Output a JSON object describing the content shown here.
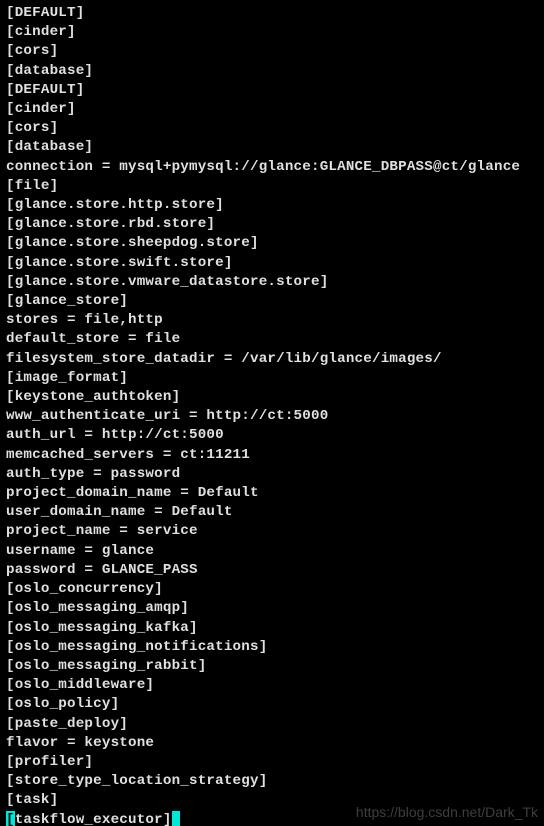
{
  "terminal": {
    "lines": [
      "[DEFAULT]",
      "[cinder]",
      "[cors]",
      "[database]",
      "[DEFAULT]",
      "[cinder]",
      "[cors]",
      "[database]",
      "connection = mysql+pymysql://glance:GLANCE_DBPASS@ct/glance",
      "[file]",
      "[glance.store.http.store]",
      "[glance.store.rbd.store]",
      "[glance.store.sheepdog.store]",
      "[glance.store.swift.store]",
      "[glance.store.vmware_datastore.store]",
      "[glance_store]",
      "stores = file,http",
      "default_store = file",
      "filesystem_store_datadir = /var/lib/glance/images/",
      "[image_format]",
      "[keystone_authtoken]",
      "www_authenticate_uri = http://ct:5000",
      "auth_url = http://ct:5000",
      "memcached_servers = ct:11211",
      "auth_type = password",
      "project_domain_name = Default",
      "user_domain_name = Default",
      "project_name = service",
      "username = glance",
      "password = GLANCE_PASS",
      "[oslo_concurrency]",
      "[oslo_messaging_amqp]",
      "[oslo_messaging_kafka]",
      "[oslo_messaging_notifications]",
      "[oslo_messaging_rabbit]",
      "[oslo_middleware]",
      "[oslo_policy]",
      "[paste_deploy]",
      "flavor = keystone",
      "[profiler]",
      "[store_type_location_strategy]",
      "[task]"
    ],
    "cursor_line": {
      "open_bracket": "[",
      "text": "taskflow_executor]",
      "cursor_glyph": " "
    }
  },
  "watermark": "https://blog.csdn.net/Dark_Tk"
}
